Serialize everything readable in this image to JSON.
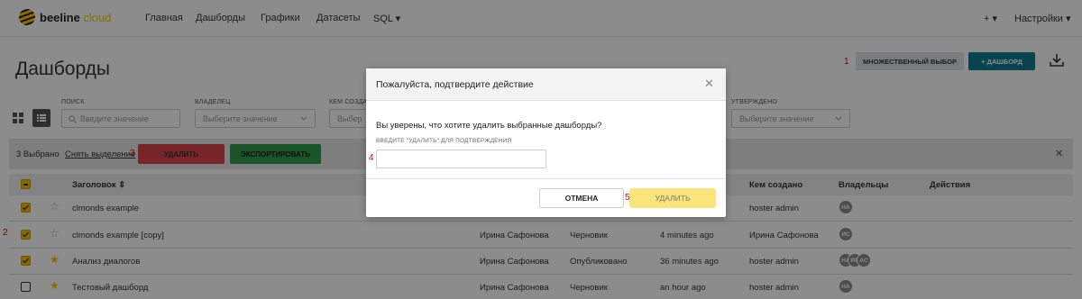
{
  "nav": {
    "logo_text_1": "beeline",
    "logo_text_2": "cloud",
    "items": [
      "Главная",
      "Дашборды",
      "Графики",
      "Датасеты",
      "SQL ▾"
    ],
    "plus": "+ ▾",
    "settings": "Настройки ▾"
  },
  "page": {
    "title": "Дашборды",
    "multi_select_label": "МНОЖЕСТВЕННЫЙ ВЫБОР",
    "add_dashboard_label": "+ ДАШБОРД"
  },
  "annotations": [
    "1",
    "2",
    "3",
    "4",
    "5"
  ],
  "filters": {
    "search_label": "ПОИСК",
    "search_placeholder": "Введите значение",
    "owner_label": "ВЛАДЕЛЕЦ",
    "owner_placeholder": "Выберите значение",
    "created_label": "КЕМ СОЗДА",
    "created_placeholder": "Выбер",
    "approved_label": "УТВЕРЖДЕНО",
    "approved_placeholder": "Выберите значение"
  },
  "selection": {
    "count": "3 Выбрано",
    "clear": "Снять выделение",
    "delete": "УДАЛИТЬ",
    "export": "ЭКСПОРТИРОВАТЬ",
    "close": "✕"
  },
  "table": {
    "headers": {
      "title": "Заголовок ⇕",
      "created_by": "Кем создано",
      "owners": "Владельцы",
      "actions": "Действия"
    },
    "rows": [
      {
        "title": "clmonds example",
        "modified_by": "",
        "status": "",
        "modified": "",
        "created_by": "hoster admin",
        "owners": [
          "HA"
        ],
        "checked": true,
        "favorite": false
      },
      {
        "title": "clmonds example [copy]",
        "modified_by": "Ирина Сафонова",
        "status": "Черновик",
        "modified": "4 minutes ago",
        "created_by": "Ирина Сафонова",
        "owners": [
          "ИС"
        ],
        "checked": true,
        "favorite": false
      },
      {
        "title": "Анализ диалогов",
        "modified_by": "Ирина Сафонова",
        "status": "Опубликовано",
        "modified": "36 minutes ago",
        "created_by": "hoster admin",
        "owners": [
          "HA",
          "ИС",
          "AC"
        ],
        "checked": true,
        "favorite": true
      },
      {
        "title": "Тестовый дашборд",
        "modified_by": "Ирина Сафонова",
        "status": "Черновик",
        "modified": "an hour ago",
        "created_by": "hoster admin",
        "owners": [
          "HA"
        ],
        "checked": false,
        "favorite": true
      }
    ]
  },
  "modal": {
    "title": "Пожалуйста, подтвердите действие",
    "close": "✕",
    "question": "Вы уверены, что хотите удалить выбранные дашборды?",
    "hint": "ВВЕДИТЕ \"УДАЛИТЬ\" ДЛЯ ПОДТВЕРЖДЕНИЯ",
    "input_value": "",
    "cancel": "ОТМЕНА",
    "confirm": "УДАЛИТЬ"
  },
  "colors": {
    "brand_yellow": "#f7c600",
    "primary_teal": "#0f7a92",
    "danger": "#d9444b",
    "success": "#2e9b47",
    "confirm_disabled": "#fbe57a"
  }
}
